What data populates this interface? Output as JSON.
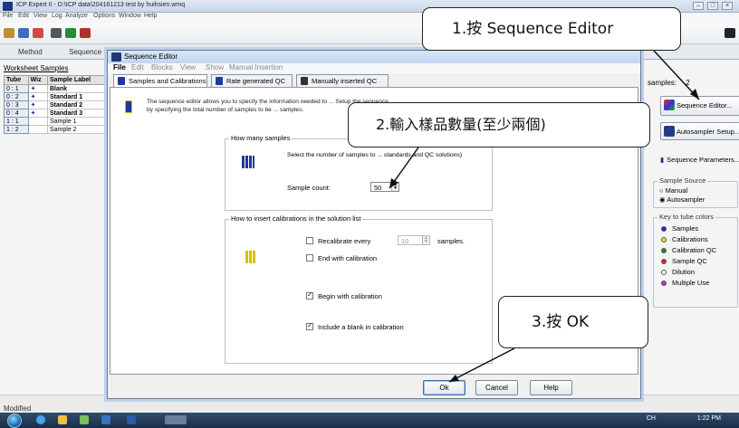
{
  "main_window": {
    "title": "ICP Expert II - D:\\ICP data\\204161213 test by huihsien.wmq",
    "menu": [
      "File",
      "Edit",
      "View",
      "Log",
      "Analyze",
      "Options",
      "Window",
      "Help"
    ],
    "tabs": [
      "Method",
      "Sequence"
    ],
    "status": "Modified"
  },
  "worksheet": {
    "title": "Worksheet Samples",
    "columns": [
      "Tube",
      "Wiz",
      "Sample Label"
    ],
    "rows": [
      {
        "tube": "0 : 1",
        "label": "Blank",
        "bold": true
      },
      {
        "tube": "0 : 2",
        "label": "Standard 1",
        "bold": true
      },
      {
        "tube": "0 : 3",
        "label": "Standard 2",
        "bold": true
      },
      {
        "tube": "0 : 4",
        "label": "Standard 3",
        "bold": true
      },
      {
        "tube": "1 : 1",
        "label": "Sample 1",
        "bold": false
      },
      {
        "tube": "1 : 2",
        "label": "Sample 2",
        "bold": false
      }
    ]
  },
  "right_panel": {
    "samples_label": "samples:",
    "samples_value": "2",
    "sequence_editor": "Sequence Editor...",
    "autosampler_setup": "Autosampler Setup...",
    "sequence_parameters": "Sequence Parameters...",
    "sample_source": {
      "title": "Sample Source",
      "options": [
        "Manual",
        "Autosampler"
      ],
      "selected": "Autosampler"
    },
    "key_colors": {
      "title": "Key to tube colors",
      "items": [
        {
          "label": "Samples",
          "color": "#1a2bd6"
        },
        {
          "label": "Calibrations",
          "color": "#f2e600"
        },
        {
          "label": "Calibration QC",
          "color": "#1f8a2c"
        },
        {
          "label": "Sample QC",
          "color": "#e02020"
        },
        {
          "label": "Dilution",
          "color": "#ffffff"
        },
        {
          "label": "Multiple Use",
          "color": "#d21fd2"
        }
      ]
    }
  },
  "dialog": {
    "title": "Sequence Editor",
    "menu": [
      "File",
      "Edit",
      "Blocks",
      "View",
      "Show",
      "Manual Insertion"
    ],
    "tabs": [
      "Samples and Calibrations",
      "Rate generated QC",
      "Manually inserted QC"
    ],
    "intro": "The sequence editor allows you to specify the information needed to ... Setup the sequence by specifying the total number of samples to be ... samples.",
    "how_many": {
      "legend": "How many samples",
      "description": "Select the number of samples to ... standards and QC solutions)",
      "count_label": "Sample count:",
      "count_value": "50"
    },
    "calibrations": {
      "legend": "How to insert calibrations in the solution list",
      "recalibrate_label": "Recalibrate every",
      "recalibrate_value": "10",
      "recalibrate_unit": "samples.",
      "recalibrate_checked": false,
      "end_label": "End with calibration",
      "end_checked": false,
      "begin_label": "Begin with calibration",
      "begin_checked": true,
      "blank_label": "Include a blank in calibration",
      "blank_checked": true
    },
    "buttons": {
      "ok": "Ok",
      "cancel": "Cancel",
      "help": "Help"
    }
  },
  "annotations": {
    "step1": "1.按 Sequence Editor",
    "step2": "2.輸入樣品數量(至少兩個)",
    "step3": "3.按 OK"
  },
  "taskbar": {
    "clock": "1:22 PM",
    "lang": "CH"
  },
  "colors": {
    "dialog_border": "#6b7a8f",
    "title_gradient": "#c2d5ee"
  }
}
